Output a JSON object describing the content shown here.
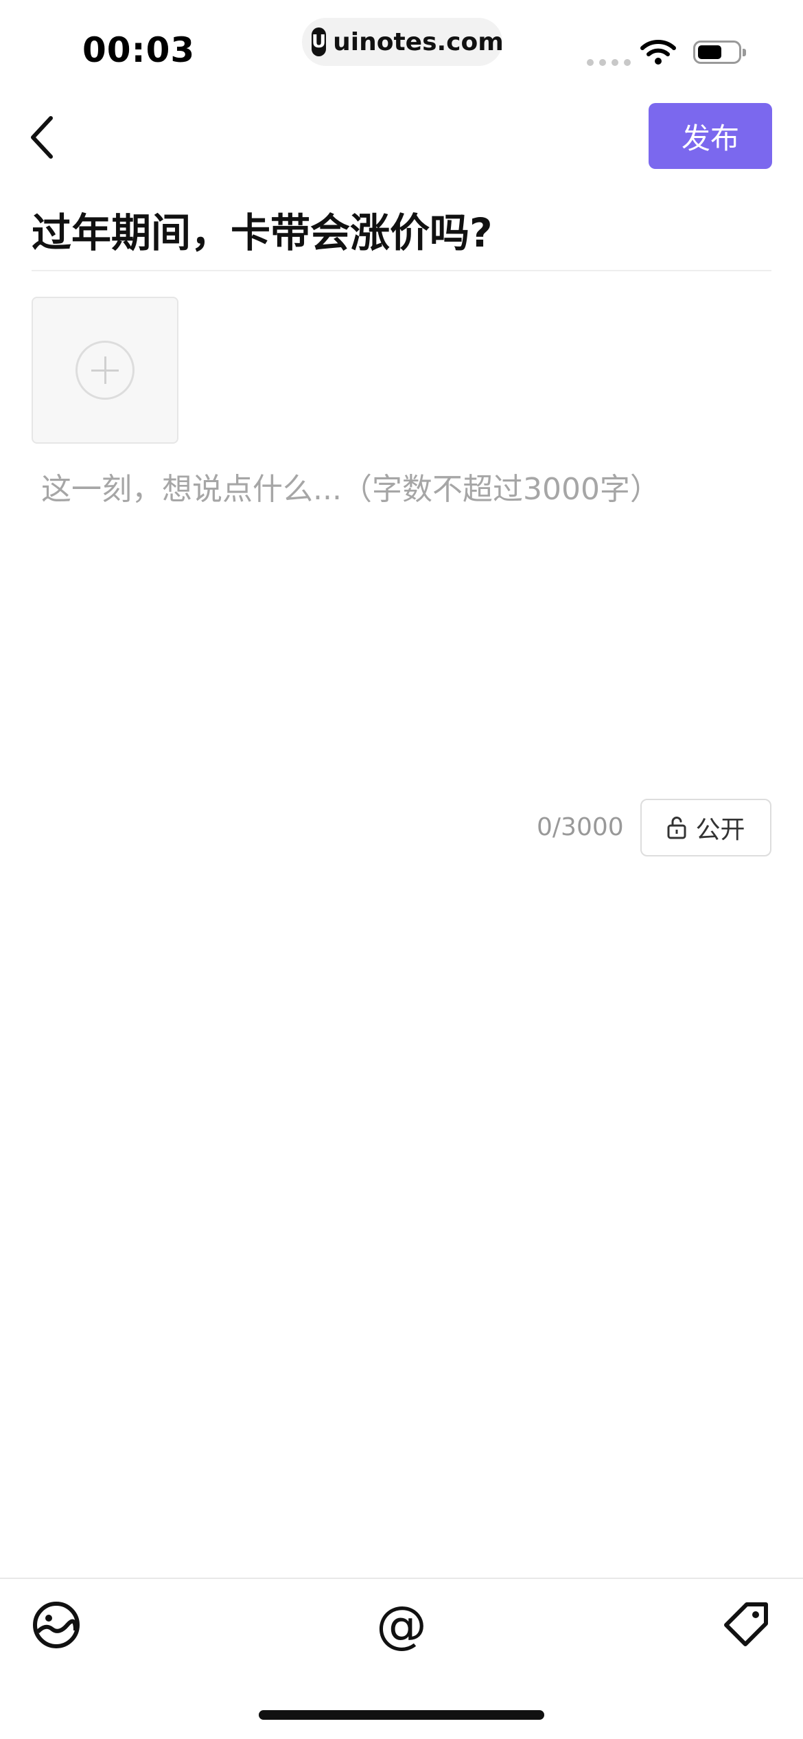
{
  "status_bar": {
    "time": "00:03",
    "watermark": "uinotes.com",
    "watermark_logo": "U"
  },
  "header": {
    "back_icon": "chevron-left-icon",
    "publish_label": "发布"
  },
  "post": {
    "title": "过年期间，卡带会涨价吗?",
    "body_placeholder": "这一刻，想说点什么...（字数不超过3000字）",
    "add_image_icon": "plus-circle-icon"
  },
  "meta": {
    "char_count": "0/3000",
    "visibility_label": "公开"
  },
  "toolbar": {
    "mention_symbol": "@",
    "items": [
      "image-icon",
      "at-mention-icon",
      "tag-icon"
    ]
  },
  "colors": {
    "accent": "#7b68ee",
    "placeholder": "#a6a6a6"
  }
}
